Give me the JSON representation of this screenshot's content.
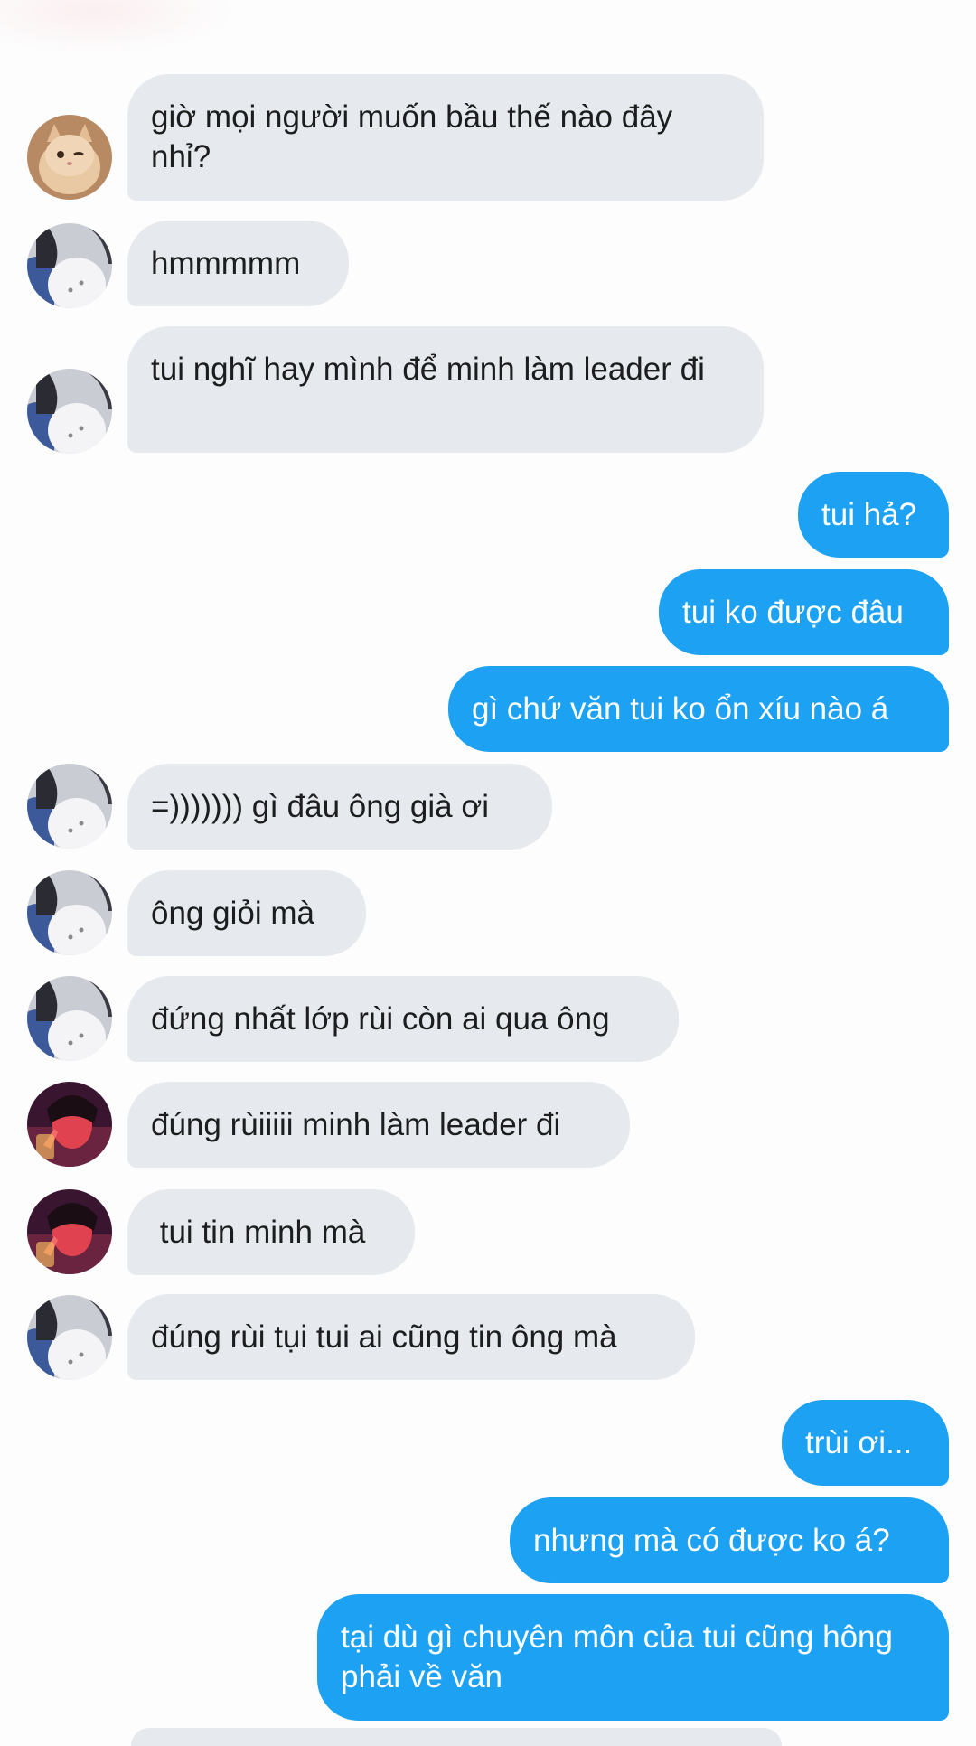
{
  "messages": [
    {
      "id": 1,
      "side": "in",
      "avatar": "cat-avatar",
      "text": "giờ mọi người muốn bầu thế nào đây nhỉ?"
    },
    {
      "id": 2,
      "side": "in",
      "avatar": "girl-white-shirt-avatar",
      "text": "hmmmmm"
    },
    {
      "id": 3,
      "side": "in",
      "avatar": "girl-white-shirt-avatar",
      "text": "tui nghĩ hay mình để minh làm leader đi"
    },
    {
      "id": 4,
      "side": "out",
      "text": "tui hả?"
    },
    {
      "id": 5,
      "side": "out",
      "text": "tui ko được đâu"
    },
    {
      "id": 6,
      "side": "out",
      "text": "gì chứ văn tui ko ổn xíu nào á"
    },
    {
      "id": 7,
      "side": "in",
      "avatar": "girl-white-shirt-avatar",
      "text": "=))))))) gì đâu ông già ơi"
    },
    {
      "id": 8,
      "side": "in",
      "avatar": "girl-white-shirt-avatar",
      "text": "ông giỏi mà"
    },
    {
      "id": 9,
      "side": "in",
      "avatar": "girl-white-shirt-avatar",
      "text": "đứng nhất lớp rùi còn ai qua ông"
    },
    {
      "id": 10,
      "side": "in",
      "avatar": "girl-red-light-avatar",
      "text": "đúng rùiiiii minh làm leader đi"
    },
    {
      "id": 11,
      "side": "in",
      "avatar": "girl-red-light-avatar",
      "text": " tui tin minh mà"
    },
    {
      "id": 12,
      "side": "in",
      "avatar": "girl-white-shirt-avatar",
      "text": "đúng rùi tụi tui ai cũng tin ông mà"
    },
    {
      "id": 13,
      "side": "out",
      "text": "trùi ơi..."
    },
    {
      "id": 14,
      "side": "out",
      "text": "nhưng mà có được ko á?"
    },
    {
      "id": 15,
      "side": "out",
      "text": "tại dù gì chuyên môn của tui cũng hông phải về văn"
    }
  ],
  "colors": {
    "incoming_bubble": "#e6e9ed",
    "outgoing_bubble": "#1da1f2",
    "incoming_text": "#1c1d1f",
    "outgoing_text": "#ffffff",
    "background": "#fdfdfd"
  }
}
